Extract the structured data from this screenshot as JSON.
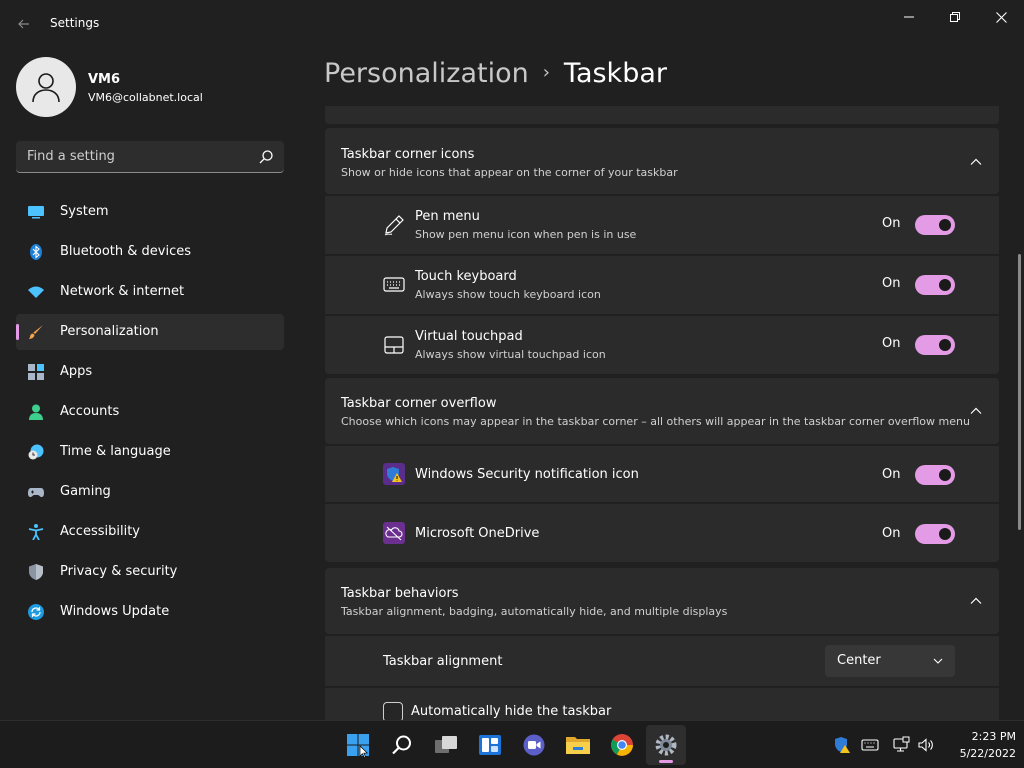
{
  "window": {
    "title": "Settings"
  },
  "user": {
    "name": "VM6",
    "email": "VM6@collabnet.local"
  },
  "search": {
    "placeholder": "Find a setting"
  },
  "sidebar": {
    "items": [
      {
        "label": "System",
        "icon": "system-icon",
        "selected": false
      },
      {
        "label": "Bluetooth & devices",
        "icon": "bluetooth-icon",
        "selected": false
      },
      {
        "label": "Network & internet",
        "icon": "wifi-icon",
        "selected": false
      },
      {
        "label": "Personalization",
        "icon": "brush-icon",
        "selected": true
      },
      {
        "label": "Apps",
        "icon": "apps-icon",
        "selected": false
      },
      {
        "label": "Accounts",
        "icon": "accounts-icon",
        "selected": false
      },
      {
        "label": "Time & language",
        "icon": "clock-globe-icon",
        "selected": false
      },
      {
        "label": "Gaming",
        "icon": "gamepad-icon",
        "selected": false
      },
      {
        "label": "Accessibility",
        "icon": "accessibility-icon",
        "selected": false
      },
      {
        "label": "Privacy & security",
        "icon": "shield-icon",
        "selected": false
      },
      {
        "label": "Windows Update",
        "icon": "update-icon",
        "selected": false
      }
    ]
  },
  "breadcrumb": {
    "parent": "Personalization",
    "separator": "›",
    "current": "Taskbar"
  },
  "sections": {
    "corner_icons": {
      "title": "Taskbar corner icons",
      "subtitle": "Show or hide icons that appear on the corner of your taskbar",
      "rows": [
        {
          "title": "Pen menu",
          "subtitle": "Show pen menu icon when pen is in use",
          "state": "On",
          "icon": "pen-icon"
        },
        {
          "title": "Touch keyboard",
          "subtitle": "Always show touch keyboard icon",
          "state": "On",
          "icon": "keyboard-icon"
        },
        {
          "title": "Virtual touchpad",
          "subtitle": "Always show virtual touchpad icon",
          "state": "On",
          "icon": "touchpad-icon"
        }
      ]
    },
    "corner_overflow": {
      "title": "Taskbar corner overflow",
      "subtitle": "Choose which icons may appear in the taskbar corner – all others will appear in the taskbar corner overflow menu",
      "rows": [
        {
          "title": "Windows Security notification icon",
          "state": "On",
          "icon": "windows-security-icon"
        },
        {
          "title": "Microsoft OneDrive",
          "state": "On",
          "icon": "onedrive-icon"
        }
      ]
    },
    "behaviors": {
      "title": "Taskbar behaviors",
      "subtitle": "Taskbar alignment, badging, automatically hide, and multiple displays",
      "alignment": {
        "label": "Taskbar alignment",
        "value": "Center"
      },
      "autohide": {
        "label": "Automatically hide the taskbar",
        "checked": false
      }
    }
  },
  "taskbar": {
    "apps": [
      "start-icon",
      "search-icon",
      "task-view-icon",
      "widgets-icon",
      "teams-chat-icon",
      "file-explorer-icon",
      "chrome-icon",
      "settings-icon"
    ],
    "clock": {
      "time": "2:23 PM",
      "date": "5/22/2022"
    }
  },
  "colors": {
    "accent": "#e49be6",
    "background": "#202020",
    "card": "#2b2b2b"
  }
}
